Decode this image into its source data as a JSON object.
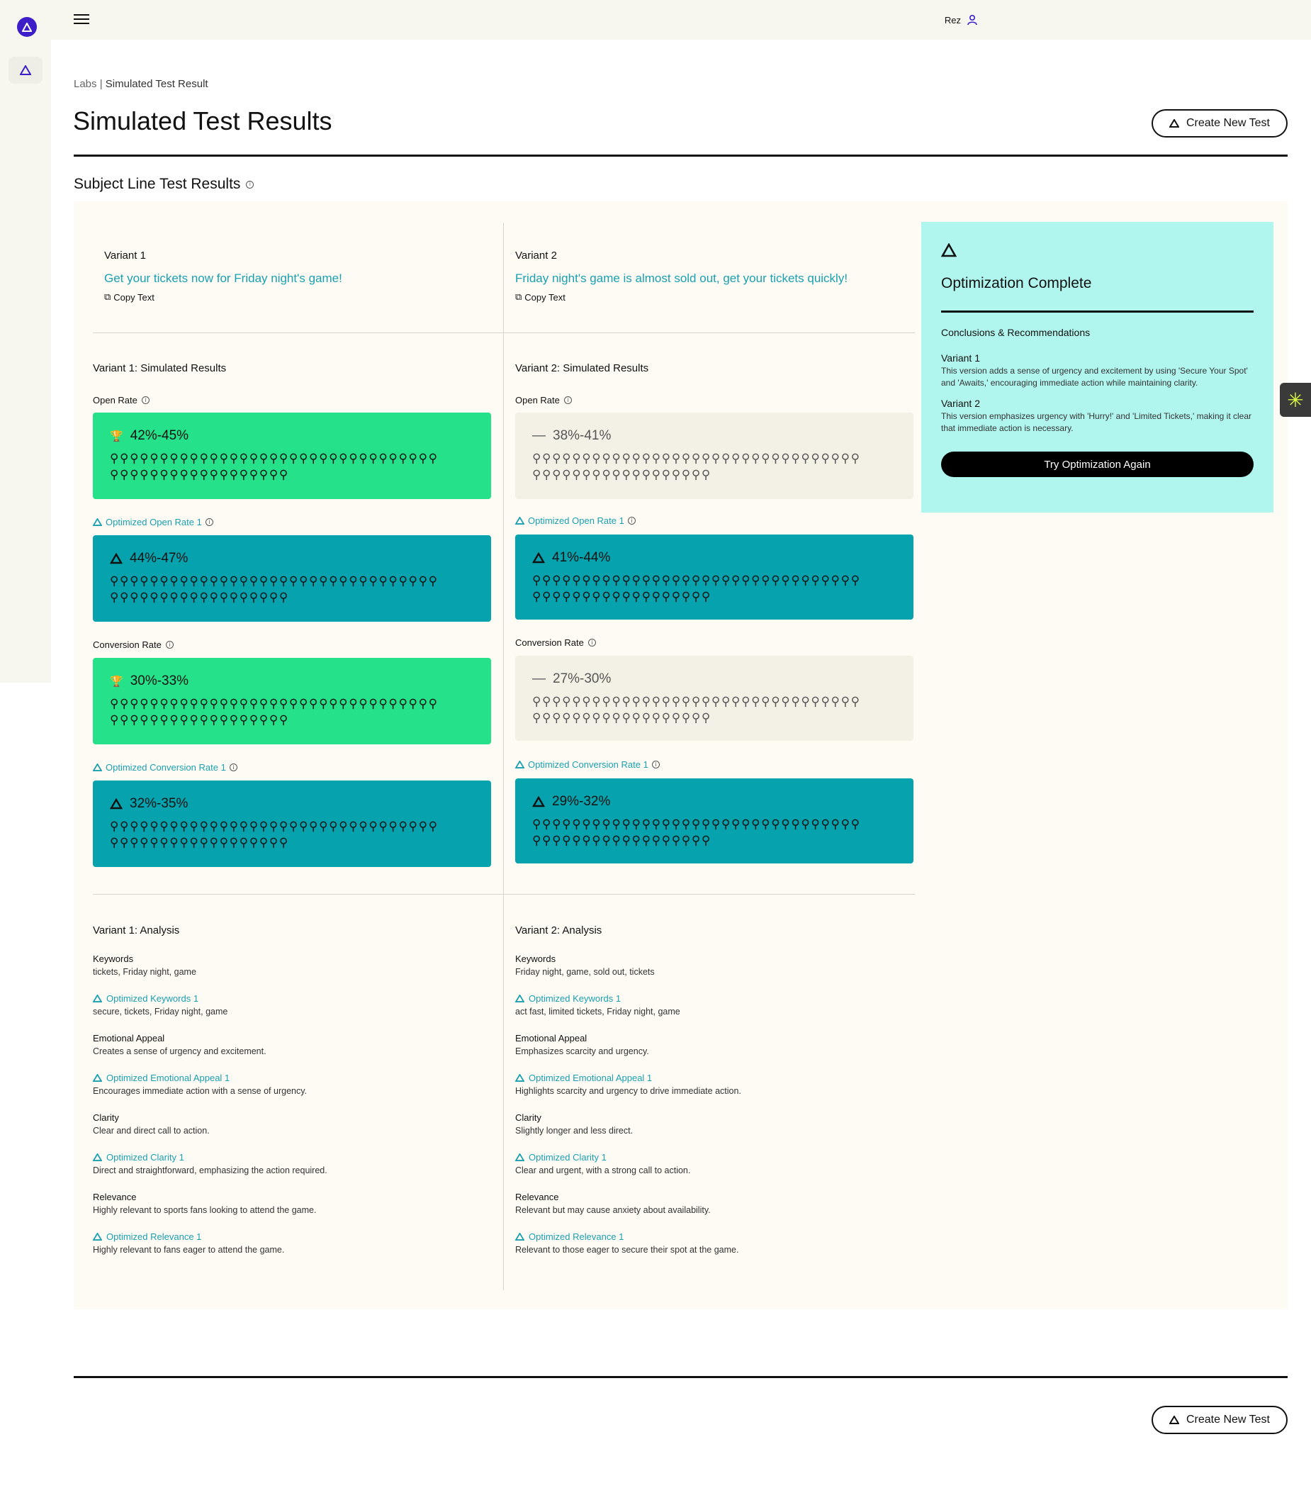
{
  "topbar": {
    "user_name": "Rez"
  },
  "breadcrumb": {
    "root": "Labs",
    "separator": "|",
    "current": "Simulated Test Result"
  },
  "page": {
    "title": "Simulated Test Results",
    "create_button": "Create New Test"
  },
  "section": {
    "title": "Subject Line Test Results",
    "info_icon": "i"
  },
  "variants": [
    {
      "name": "Variant 1",
      "text": "Get your tickets now for Friday night's game!",
      "copy_label": "Copy Text",
      "results_title": "Variant 1: Simulated Results",
      "open_rate_label": "Open Rate",
      "open_rate": "42%-45%",
      "opt_open_rate_label": "Optimized Open Rate 1",
      "opt_open_rate": "44%-47%",
      "conversion_label": "Conversion Rate",
      "conversion_rate": "30%-33%",
      "opt_conversion_label": "Optimized Conversion Rate 1",
      "opt_conversion_rate": "32%-35%",
      "analysis_title": "Variant 1: Analysis",
      "analysis": {
        "keywords_label": "Keywords",
        "keywords": "tickets, Friday night, game",
        "opt_keywords_label": "Optimized Keywords 1",
        "opt_keywords": "secure, tickets, Friday night, game",
        "emotional_label": "Emotional Appeal",
        "emotional": "Creates a sense of urgency and excitement.",
        "opt_emotional_label": "Optimized Emotional Appeal 1",
        "opt_emotional": "Encourages immediate action with a sense of urgency.",
        "clarity_label": "Clarity",
        "clarity": "Clear and direct call to action.",
        "opt_clarity_label": "Optimized Clarity 1",
        "opt_clarity": "Direct and straightforward, emphasizing the action required.",
        "relevance_label": "Relevance",
        "relevance": "Highly relevant to sports fans looking to attend the game.",
        "opt_relevance_label": "Optimized Relevance 1",
        "opt_relevance": "Highly relevant to fans eager to attend the game."
      }
    },
    {
      "name": "Variant 2",
      "text": "Friday night's game is almost sold out, get your tickets quickly!",
      "copy_label": "Copy Text",
      "results_title": "Variant 2: Simulated Results",
      "open_rate_label": "Open Rate",
      "open_rate": "38%-41%",
      "opt_open_rate_label": "Optimized Open Rate 1",
      "opt_open_rate": "41%-44%",
      "conversion_label": "Conversion Rate",
      "conversion_rate": "27%-30%",
      "opt_conversion_label": "Optimized Conversion Rate 1",
      "opt_conversion_rate": "29%-32%",
      "analysis_title": "Variant 2: Analysis",
      "analysis": {
        "keywords_label": "Keywords",
        "keywords": "Friday night, game, sold out, tickets",
        "opt_keywords_label": "Optimized Keywords 1",
        "opt_keywords": "act fast, limited tickets, Friday night, game",
        "emotional_label": "Emotional Appeal",
        "emotional": "Emphasizes scarcity and urgency.",
        "opt_emotional_label": "Optimized Emotional Appeal 1",
        "opt_emotional": "Highlights scarcity and urgency to drive immediate action.",
        "clarity_label": "Clarity",
        "clarity": "Slightly longer and less direct.",
        "opt_clarity_label": "Optimized Clarity 1",
        "opt_clarity": "Clear and urgent, with a strong call to action.",
        "relevance_label": "Relevance",
        "relevance": "Relevant but may cause anxiety about availability.",
        "opt_relevance_label": "Optimized Relevance 1",
        "opt_relevance": "Relevant to those eager to secure their spot at the game."
      }
    }
  ],
  "optimization": {
    "title": "Optimization Complete",
    "subtitle": "Conclusions & Recommendations",
    "v1_name": "Variant 1",
    "v1_text": "This version adds a sense of urgency and excitement by using 'Secure Your Spot' and 'Awaits,' encouraging immediate action while maintaining clarity.",
    "v2_name": "Variant 2",
    "v2_text": "This version emphasizes urgency with 'Hurry!' and 'Limited Tickets,' making it clear that immediate action is necessary.",
    "button": "Try Optimization Again"
  },
  "icons": {
    "trophy": "🏆",
    "dash": "—",
    "person": "👤",
    "copy": "⧉",
    "widget": "✳"
  },
  "people_row": "⚲⚲⚲⚲⚲⚲⚲⚲⚲⚲⚲⚲⚲⚲⚲⚲⚲⚲⚲⚲⚲⚲⚲⚲⚲⚲⚲⚲⚲⚲⚲⚲⚲",
  "people_row2": "⚲⚲⚲⚲⚲⚲⚲⚲⚲⚲⚲⚲⚲⚲⚲⚲⚲⚲",
  "colors": {
    "accent_teal": "#06a3ae",
    "winner_green": "#25e28a",
    "neutral_beige": "#f3f1e6",
    "optimization_bg": "#b0f6ee",
    "brand_purple": "#3d1ec9",
    "link_teal": "#1aa0b0"
  }
}
